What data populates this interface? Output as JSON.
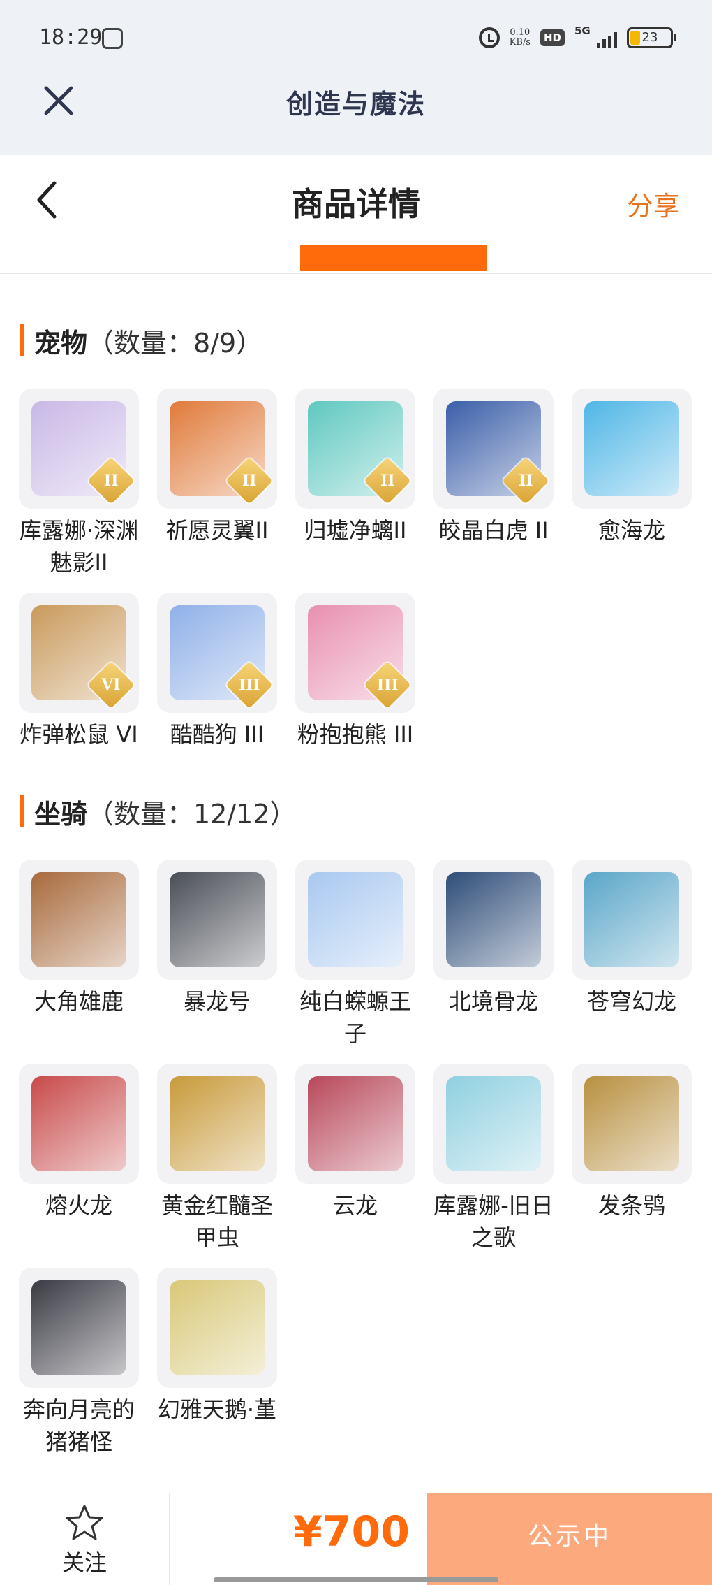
{
  "status_bar": {
    "time": "18:29",
    "net_speed": "0.10",
    "net_unit": "KB/s",
    "hd": "HD",
    "network": "5G",
    "battery": "23"
  },
  "app": {
    "title": "创造与魔法"
  },
  "nav": {
    "title": "商品详情",
    "share": "分享"
  },
  "pets": {
    "title": "宠物",
    "count": "（数量：8/9）",
    "items": [
      {
        "name": "库露娜·深渊魅影II",
        "grade": "II",
        "color": "#c9b8e6"
      },
      {
        "name": "祈愿灵翼II",
        "grade": "II",
        "color": "#e07a3a"
      },
      {
        "name": "归墟净螭II",
        "grade": "II",
        "color": "#5fc8c0"
      },
      {
        "name": "皎晶白虎 II",
        "grade": "II",
        "color": "#3a5ea8"
      },
      {
        "name": "愈海龙",
        "grade": "",
        "color": "#4fb6e6"
      },
      {
        "name": "炸弹松鼠 VI",
        "grade": "VI",
        "color": "#c99a5c"
      },
      {
        "name": "酷酷狗 III",
        "grade": "III",
        "color": "#8fb0e8"
      },
      {
        "name": "粉抱抱熊 III",
        "grade": "III",
        "color": "#e88fb0"
      }
    ]
  },
  "mounts": {
    "title": "坐骑",
    "count": "（数量：12/12）",
    "items": [
      {
        "name": "大角雄鹿",
        "color": "#a86a3c"
      },
      {
        "name": "暴龙号",
        "color": "#4a4e56"
      },
      {
        "name": "纯白蝾螈王子",
        "color": "#a8c8f0"
      },
      {
        "name": "北境骨龙",
        "color": "#2e4d78"
      },
      {
        "name": "苍穹幻龙",
        "color": "#5aa6c8"
      },
      {
        "name": "熔火龙",
        "color": "#c84a4a"
      },
      {
        "name": "黄金红髓圣甲虫",
        "color": "#c89a3a"
      },
      {
        "name": "云龙",
        "color": "#b8485a"
      },
      {
        "name": "库露娜-旧日之歌",
        "color": "#8fd0e0"
      },
      {
        "name": "发条鸮",
        "color": "#b89040"
      },
      {
        "name": "奔向月亮的猪猪怪",
        "color": "#3a3a44"
      },
      {
        "name": "幻雅天鹅·堇",
        "color": "#d8c878"
      }
    ]
  },
  "bottom": {
    "follow": "关注",
    "price": "¥700",
    "status": "公示中"
  }
}
